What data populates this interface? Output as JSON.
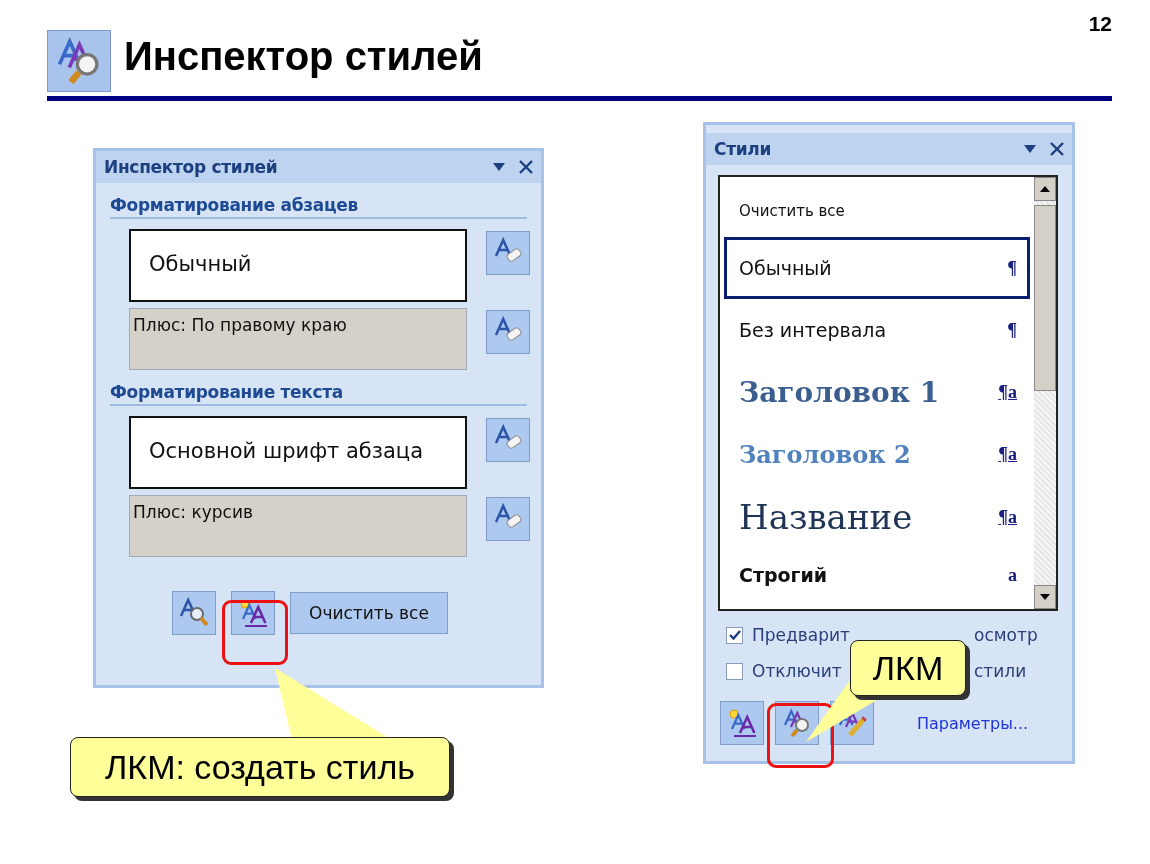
{
  "slide_number": "12",
  "title": "Инспектор стилей",
  "inspector": {
    "title": "Инспектор стилей",
    "sections": [
      {
        "heading": "Форматирование абзацев",
        "base": "Обычный",
        "extra": "Плюс: По правому краю"
      },
      {
        "heading": "Форматирование текста",
        "base": "Основной шрифт абзаца",
        "extra": "Плюс: курсив"
      }
    ],
    "clear_button": "Очистить все"
  },
  "styles_panel": {
    "title": "Стили",
    "items": [
      {
        "label": "Очистить все",
        "kind": "clear",
        "selected": false
      },
      {
        "label": "Обычный",
        "kind": "normal",
        "type_glyph": "¶",
        "selected": true
      },
      {
        "label": "Без интервала",
        "kind": "normal",
        "type_glyph": "¶",
        "selected": false
      },
      {
        "label": "Заголовок 1",
        "kind": "heading1",
        "type_glyph": "¶a",
        "selected": false
      },
      {
        "label": "Заголовок 2",
        "kind": "heading2",
        "type_glyph": "¶a",
        "selected": false
      },
      {
        "label": "Название",
        "kind": "title",
        "type_glyph": "¶a",
        "selected": false
      },
      {
        "label": "Строгий",
        "kind": "strong",
        "type_glyph": "a",
        "selected": false
      }
    ],
    "options": [
      {
        "label_start": "Предварит",
        "label_end": "осмотр",
        "checked": true
      },
      {
        "label_start": "Отключит",
        "label_end": "стили",
        "checked": false
      }
    ],
    "link": "Параметры..."
  },
  "callouts": [
    {
      "text": "ЛКМ: создать стиль"
    },
    {
      "text": "ЛКМ"
    }
  ]
}
